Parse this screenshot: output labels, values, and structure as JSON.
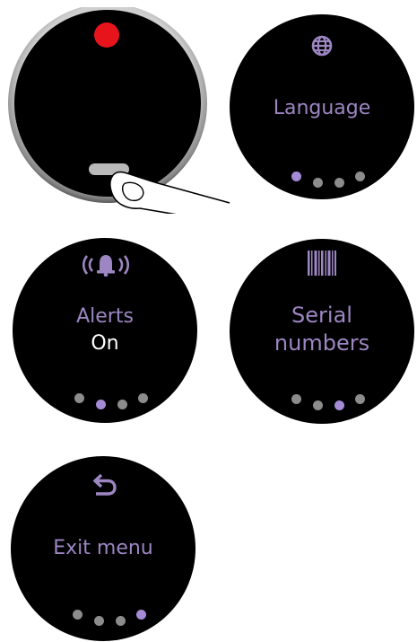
{
  "device": {
    "indicator_color": "#e8141c",
    "button_color": "#b9b9b9"
  },
  "screens": [
    {
      "id": "language",
      "icon": "globe-icon",
      "label": "Language",
      "active_dot": 0,
      "dot_count": 4
    },
    {
      "id": "alerts",
      "icon": "bell-alert-icon",
      "label": "Alerts",
      "value": "On",
      "active_dot": 1,
      "dot_count": 4
    },
    {
      "id": "serial",
      "icon": "barcode-icon",
      "label_line1": "Serial",
      "label_line2": "numbers",
      "active_dot": 2,
      "dot_count": 4
    },
    {
      "id": "exit",
      "icon": "return-arrow-icon",
      "label": "Exit menu",
      "active_dot": 3,
      "dot_count": 4
    }
  ],
  "colors": {
    "text_accent": "#9d86c2",
    "text_value": "#ffffff",
    "dot_inactive": "#8c8c8c",
    "dot_active": "#a58bd6",
    "screen_bg": "#000000"
  }
}
